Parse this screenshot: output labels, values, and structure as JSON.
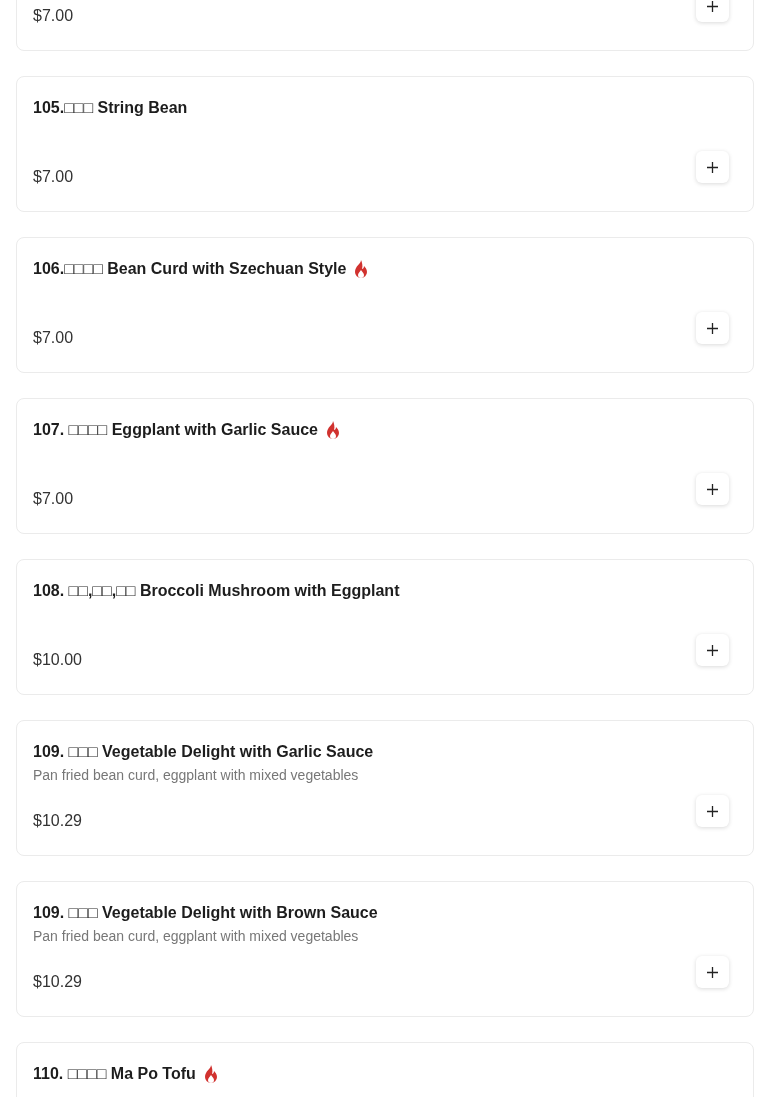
{
  "menu_items": [
    {
      "price": "$7.00"
    },
    {
      "title": "105.□□□ String Bean",
      "price": "$7.00",
      "spicy": false
    },
    {
      "title": "106.□□□□ Bean Curd with Szechuan Style",
      "price": "$7.00",
      "spicy": true
    },
    {
      "title": "107. □□□□ Eggplant with Garlic Sauce",
      "price": "$7.00",
      "spicy": true
    },
    {
      "title": "108. □□,□□,□□ Broccoli Mushroom with Eggplant",
      "price": "$10.00",
      "spicy": false
    },
    {
      "title": "109. □□□ Vegetable Delight with Garlic Sauce",
      "description": "Pan fried bean curd, eggplant with mixed vegetables",
      "price": "$10.29",
      "spicy": false
    },
    {
      "title": "109. □□□ Vegetable Delight with Brown Sauce",
      "description": "Pan fried bean curd, eggplant with mixed vegetables",
      "price": "$10.29",
      "spicy": false
    },
    {
      "title": "110. □□□□ Ma Po Tofu",
      "spicy": true
    }
  ]
}
